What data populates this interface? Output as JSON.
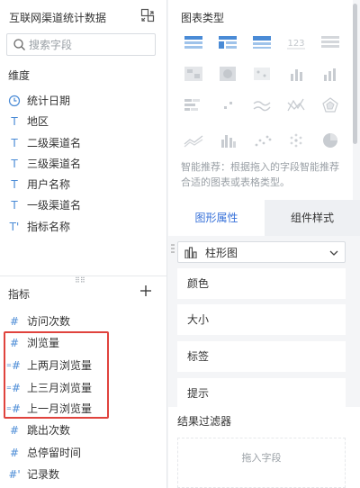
{
  "left": {
    "dataset_title": "互联网渠道统计数据",
    "search_placeholder": "搜索字段",
    "dimensions": {
      "header": "维度",
      "items": [
        {
          "icon": "clock-icon",
          "symbol": "◷",
          "label": "统计日期"
        },
        {
          "icon": "text-type-icon",
          "symbol": "T",
          "label": "地区"
        },
        {
          "icon": "text-type-icon",
          "symbol": "T",
          "label": "二级渠道名"
        },
        {
          "icon": "text-type-icon",
          "symbol": "T",
          "label": "三级渠道名"
        },
        {
          "icon": "text-type-icon",
          "symbol": "T",
          "label": "用户名称"
        },
        {
          "icon": "text-type-icon",
          "symbol": "T",
          "label": "一级渠道名"
        },
        {
          "icon": "text-calc-type-icon",
          "symbol": "T'",
          "label": "指标名称"
        }
      ]
    },
    "metrics": {
      "header": "指标",
      "items": [
        {
          "icon": "hash-icon",
          "symbol": "#",
          "label": "访问次数"
        },
        {
          "icon": "hash-icon",
          "symbol": "#",
          "label": "浏览量"
        },
        {
          "icon": "hash-compare-icon",
          "symbol": "#",
          "label": "上两月浏览量"
        },
        {
          "icon": "hash-compare-icon",
          "symbol": "#",
          "label": "上三月浏览量"
        },
        {
          "icon": "hash-compare-icon",
          "symbol": "#",
          "label": "上一月浏览量"
        },
        {
          "icon": "hash-icon",
          "symbol": "#",
          "label": "跳出次数"
        },
        {
          "icon": "hash-icon",
          "symbol": "#",
          "label": "总停留时间"
        },
        {
          "icon": "hash-calc-icon",
          "symbol": "#'",
          "label": "记录数"
        }
      ]
    }
  },
  "right": {
    "chart_type_title": "图表类型",
    "chart_types": [
      "table-icon",
      "cross-table-icon",
      "group-table-icon",
      "kpi-123-icon",
      "detail-list-icon",
      "map-region-icon",
      "map-heat-icon",
      "map-point-icon",
      "bar-chart-icon",
      "column-chart-icon",
      "stacked-bar-icon",
      "scatter-small-icon",
      "line-chart-icon",
      "radar-line-icon",
      "radar-icon",
      "area-chart-icon",
      "grouped-column-icon",
      "dot-scatter-icon",
      "dot-circle-icon",
      "pie-chart-icon"
    ],
    "chart_hint": "智能推荐：根据拖入的字段智能推荐合适的图表或表格类型。",
    "tabs": [
      "图形属性",
      "组件样式"
    ],
    "chart_select": "柱形图",
    "properties": [
      "颜色",
      "大小",
      "标签",
      "提示"
    ],
    "filter_title": "结果过滤器",
    "filter_placeholder": "拖入字段"
  },
  "colors": {
    "accent": "#3670d9",
    "icon_blue": "#4a8bd6",
    "highlight_red": "#e0433d"
  }
}
